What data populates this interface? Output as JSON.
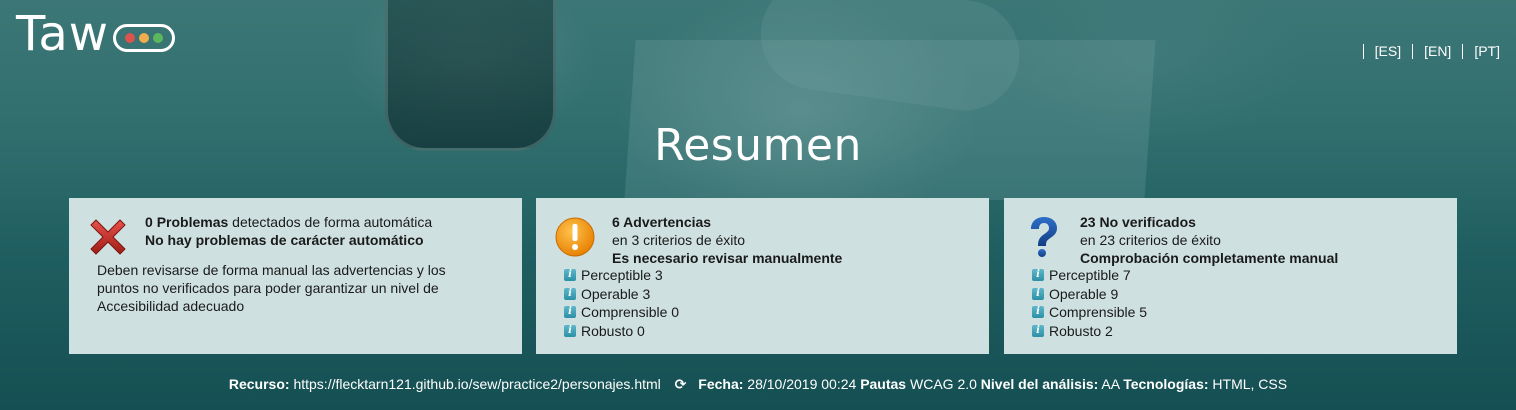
{
  "logo": {
    "text": "Taw",
    "dot_colors": [
      "#d9534f",
      "#f0ad4e",
      "#5cb85c"
    ]
  },
  "languages": [
    "[ES]",
    "[EN]",
    "[PT]"
  ],
  "page_title": "Resumen",
  "cards": {
    "problems": {
      "count": "0",
      "count_label": "Problemas",
      "detail": " detectados de forma automática",
      "subtitle": "No hay problemas de carácter automático",
      "note": "Deben revisarse de forma manual las advertencias y los puntos no verificados para poder garantizar un nivel de Accesibilidad adecuado",
      "icon": "red-x-icon"
    },
    "warnings": {
      "title": "6 Advertencias",
      "criteria": "en 3 criterios de éxito",
      "subtitle": "Es necesario revisar manualmente",
      "icon": "warning-icon",
      "items": [
        "Perceptible 3",
        "Operable 3",
        "Comprensible 0",
        "Robusto 0"
      ]
    },
    "unverified": {
      "title": "23 No verificados",
      "criteria": "en 23 criterios de éxito",
      "subtitle": "Comprobación completamente manual",
      "icon": "question-icon",
      "items": [
        "Perceptible 7",
        "Operable 9",
        "Comprensible 5",
        "Robusto 2"
      ]
    }
  },
  "footer": {
    "resource_label": "Recurso:",
    "resource_value": "https://flecktarn121.github.io/sew/practice2/personajes.html",
    "date_label": "Fecha:",
    "date_value": "28/10/2019 00:24",
    "guidelines_label": "Pautas",
    "guidelines_value": "WCAG 2.0",
    "level_label": "Nivel del análisis:",
    "level_value": "AA",
    "tech_label": "Tecnologías:",
    "tech_value": "HTML, CSS"
  },
  "colors": {
    "card_background": "#cfe0e1",
    "header_background": "#2f6d6d",
    "warning_orange": "#f39c12",
    "error_red": "#c0392b",
    "question_blue": "#1a4f9c"
  }
}
